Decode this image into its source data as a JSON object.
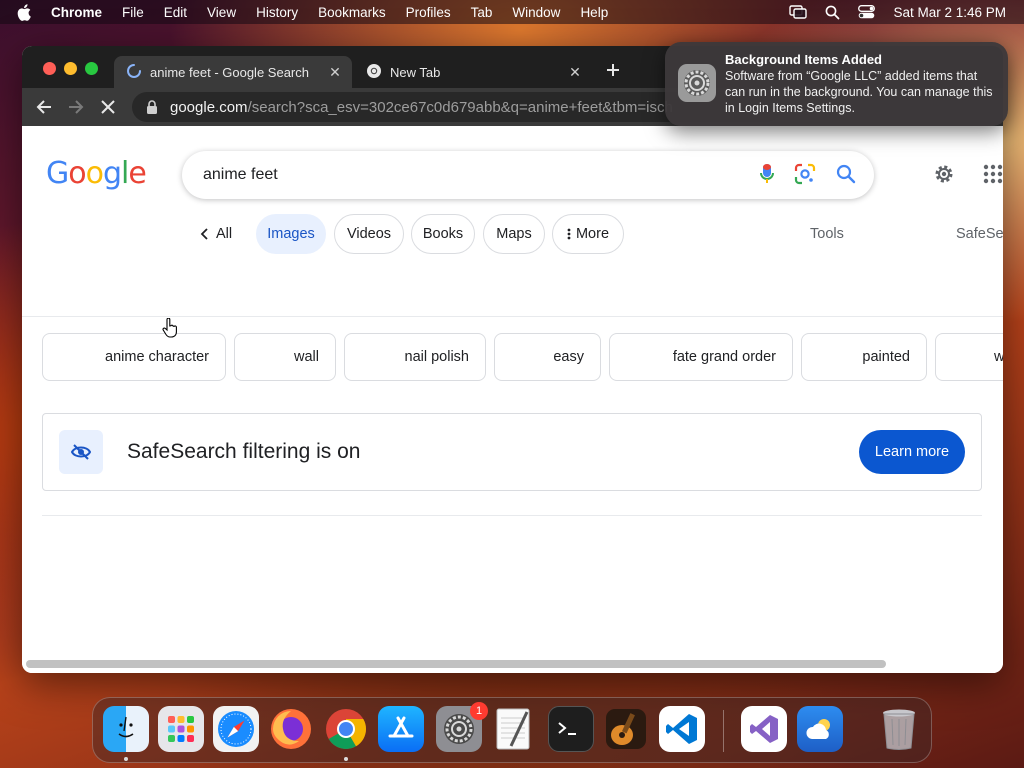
{
  "menubar": {
    "app_name": "Chrome",
    "items": [
      "File",
      "Edit",
      "View",
      "History",
      "Bookmarks",
      "Profiles",
      "Tab",
      "Window",
      "Help"
    ],
    "datetime": "Sat Mar 2  1:46 PM"
  },
  "browser": {
    "tabs": [
      {
        "title": "anime feet - Google Search",
        "loading": true
      },
      {
        "title": "New Tab",
        "loading": false
      }
    ],
    "url_host": "google.com",
    "url_path": "/search?sca_esv=302ce67c0d679abb&q=anime+feet&tbm=isch"
  },
  "google": {
    "logo_text": "Google",
    "query": "anime feet",
    "filters": {
      "back_all": "All",
      "images": "Images",
      "videos": "Videos",
      "books": "Books",
      "maps": "Maps",
      "more": "More",
      "tools": "Tools",
      "safesearch": "SafeSe"
    },
    "refinements": [
      "anime character",
      "wall",
      "nail polish",
      "easy",
      "fate grand order",
      "painted",
      "w"
    ],
    "safesearch_notice": {
      "title": "SafeSearch filtering is on",
      "button": "Learn more"
    }
  },
  "notification": {
    "title": "Background Items Added",
    "body": "Software from “Google LLC” added items that can run in the background. You can manage this in Login Items Settings."
  },
  "dock": {
    "apps": [
      "Finder",
      "Launchpad",
      "Safari",
      "Firefox",
      "Chrome",
      "App Store",
      "System Settings",
      "TextEdit",
      "Terminal",
      "GarageBand",
      "Visual Studio Code",
      "Visual Studio",
      "Weather",
      "Trash"
    ],
    "settings_badge": "1"
  },
  "colors": {
    "accent_blue": "#0b57d0",
    "chip_active_bg": "#e8f0fe",
    "google_blue": "#4285f4",
    "google_red": "#ea4335",
    "google_yellow": "#fbbc05",
    "google_green": "#34a853"
  }
}
